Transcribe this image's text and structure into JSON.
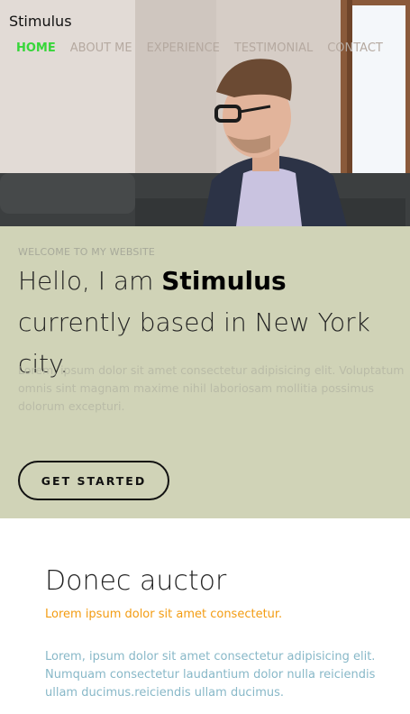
{
  "brand": "Stimulus",
  "nav": [
    {
      "label": "HOME",
      "active": true
    },
    {
      "label": "ABOUT ME",
      "active": false
    },
    {
      "label": "EXPERIENCE",
      "active": false
    },
    {
      "label": "TESTIMONIAL",
      "active": false
    },
    {
      "label": "CONTACT",
      "active": false
    }
  ],
  "welcome": {
    "kicker": "WELCOME TO MY WEBSITE",
    "title_prefix": "Hello, I am ",
    "title_name": "Stimulus",
    "title_suffix": " currently based in New York city.",
    "paragraph": "Lorem, ipsum dolor sit amet consectetur adipisicing elit. Voluptatum omnis sint magnam maxime nihil laboriosam mollitia possimus dolorum excepturi.",
    "cta_label": "GET STARTED"
  },
  "section": {
    "title": "Donec auctor",
    "subtitle": "Lorem ipsum dolor sit amet consectetur.",
    "paragraph": "Lorem, ipsum dolor sit amet consectetur adipisicing elit. Numquam consectetur laudantium dolor nulla reiciendis ullam ducimus.reiciendis ullam ducimus."
  },
  "colors": {
    "nav_active": "#37d63a",
    "nav_inactive": "#b5a9a0",
    "welcome_bg": "#d0d3b7",
    "accent_orange": "#f39c12",
    "paragraph_blue": "#88b8c8"
  }
}
